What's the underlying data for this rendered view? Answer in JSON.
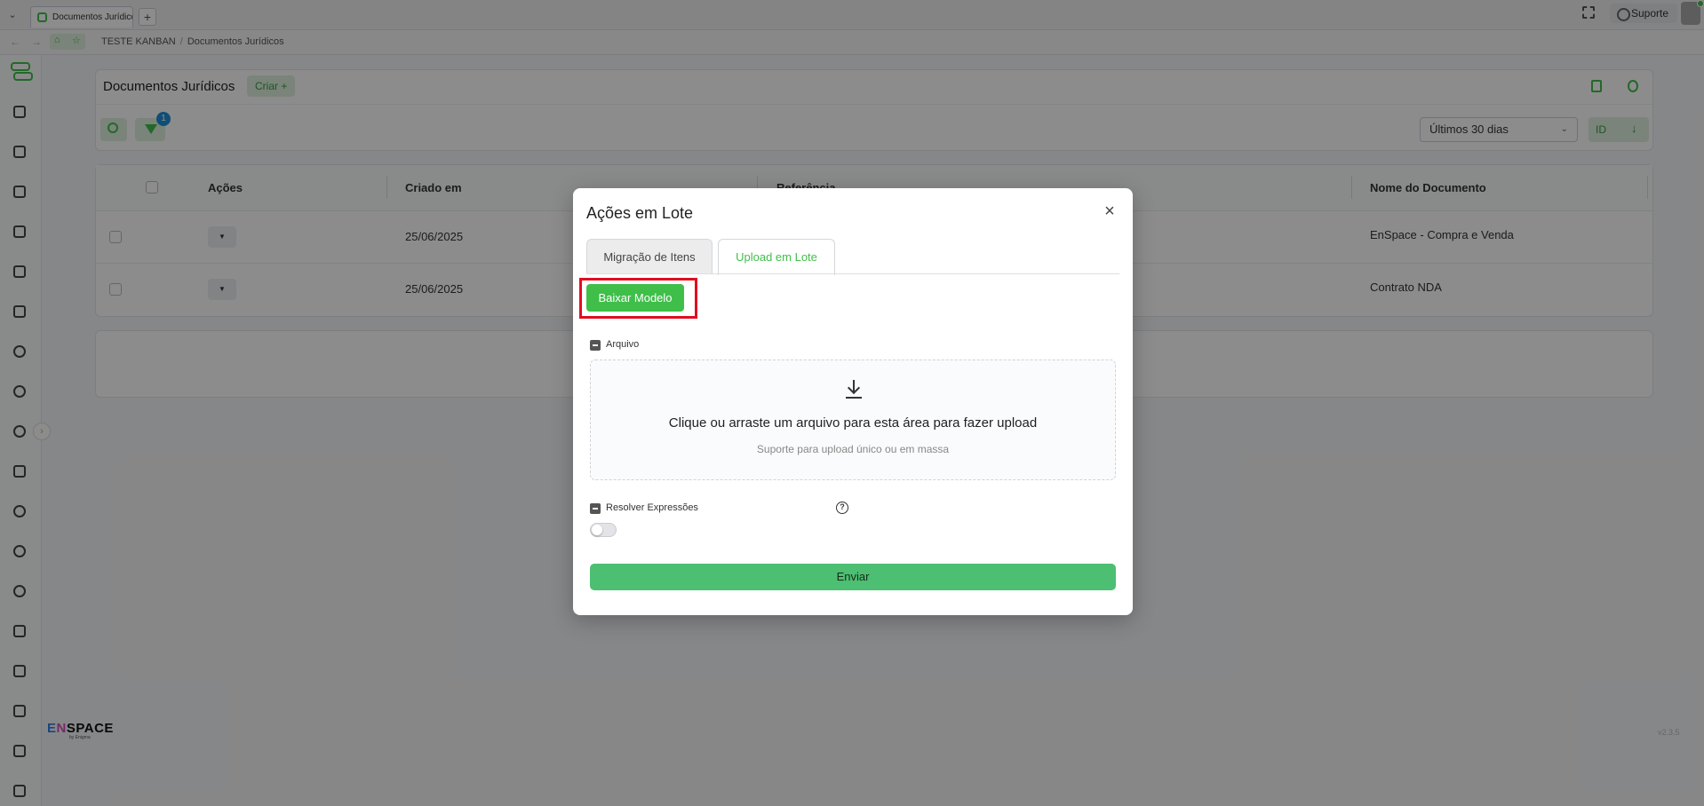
{
  "browser": {
    "tab_title": "Documentos Jurídicos",
    "support_label": "Suporte",
    "breadcrumb": [
      "TESTE KANBAN",
      "Documentos Jurídicos"
    ]
  },
  "header": {
    "title": "Documentos Jurídicos",
    "create_label": "Criar +",
    "filter_count": "1",
    "period": "Últimos 30 dias",
    "sort_field": "ID"
  },
  "table": {
    "columns": [
      "Ações",
      "Criado em",
      "Referência",
      "Nome do Documento"
    ],
    "rows": [
      {
        "created": "25/06/2025",
        "name": "EnSpace - Compra e Venda"
      },
      {
        "created": "25/06/2025",
        "name": "Contrato NDA"
      }
    ]
  },
  "sidebar": {
    "brand": "ENSPACE",
    "brand_sub": "by Enigma",
    "version": "v2.3.5"
  },
  "modal": {
    "title": "Ações em Lote",
    "tabs": [
      "Migração de Itens",
      "Upload em Lote"
    ],
    "active_tab": "Upload em Lote",
    "download_template_label": "Baixar Modelo",
    "file_label": "Arquivo",
    "dropzone_text": "Clique ou arraste um arquivo para esta área para fazer upload",
    "dropzone_hint": "Suporte para upload único ou em massa",
    "resolve_label": "Resolver Expressões",
    "submit_label": "Enviar"
  },
  "colors": {
    "accent": "#3fbf4a",
    "highlight": "#e00d1f",
    "submit": "#4cbf72"
  }
}
